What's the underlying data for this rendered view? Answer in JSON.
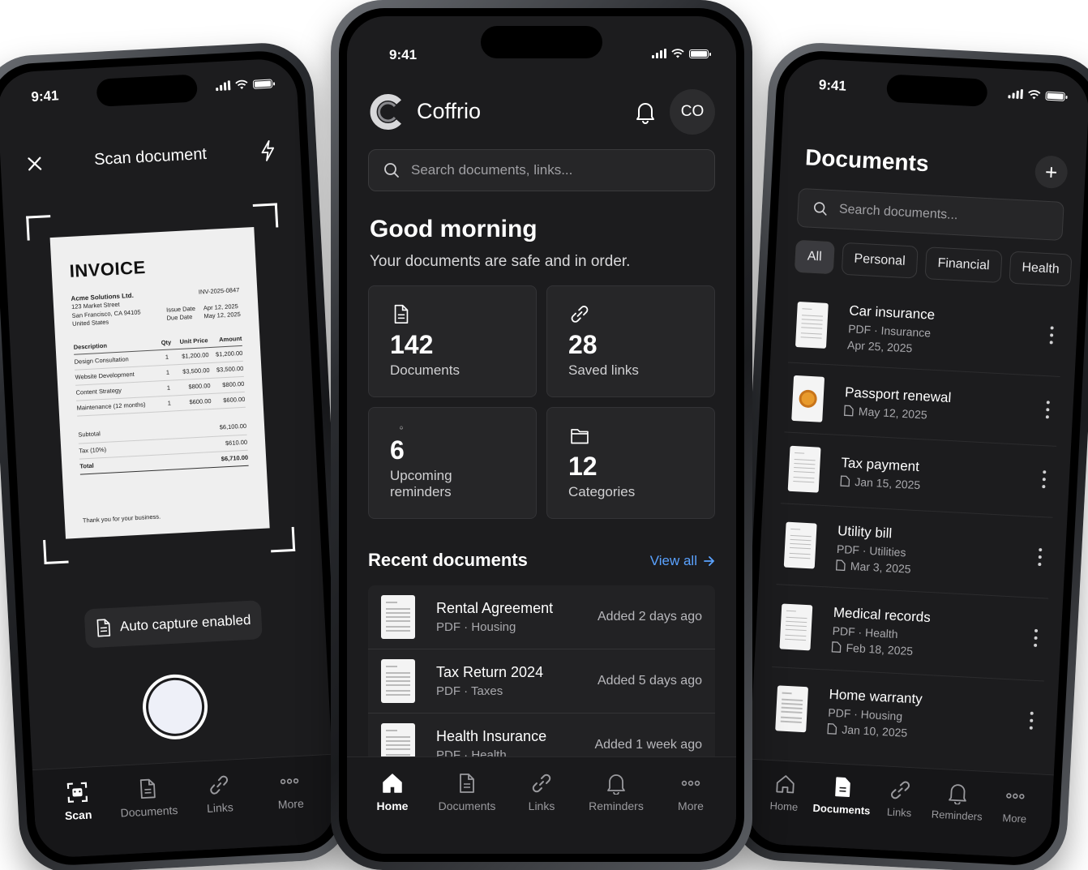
{
  "status": {
    "time": "9:41"
  },
  "scan_phone": {
    "title": "Scan document",
    "invoice": {
      "title": "INVOICE",
      "number": "INV-2025-0847",
      "company": "Acme Solutions Ltd.",
      "address_lines": [
        "123 Market Street",
        "San Francisco, CA 94105",
        "United States"
      ],
      "issue_label": "Issue Date",
      "issue_value": "Apr 12, 2025",
      "due_label": "Due Date",
      "due_value": "May 12, 2025",
      "headers": [
        "Description",
        "Qty",
        "Unit Price",
        "Amount"
      ],
      "rows": [
        [
          "Design Consultation",
          "1",
          "$1,200.00",
          "$1,200.00"
        ],
        [
          "Website Development",
          "1",
          "$3,500.00",
          "$3,500.00"
        ],
        [
          "Content Strategy",
          "1",
          "$800.00",
          "$800.00"
        ],
        [
          "Maintenance (12 months)",
          "1",
          "$600.00",
          "$600.00"
        ]
      ],
      "subtotal_label": "Subtotal",
      "subtotal_value": "$6,100.00",
      "tax_label": "Tax (10%)",
      "tax_value": "$610.00",
      "total_label": "Total",
      "total_value": "$6,710.00",
      "thanks": "Thank you for your business."
    },
    "auto_capture": "Auto capture enabled",
    "tabs": [
      "Scan",
      "Documents",
      "Links",
      "More"
    ]
  },
  "home_phone": {
    "app_name": "Coffrio",
    "avatar": "CO",
    "search_placeholder": "Search documents, links...",
    "greeting": "Good morning",
    "greeting_sub": "Your documents are safe and in order.",
    "stats": [
      {
        "value": "142",
        "label": "Documents"
      },
      {
        "value": "28",
        "label": "Saved links"
      },
      {
        "value": "6",
        "label": "Upcoming reminders"
      },
      {
        "value": "12",
        "label": "Categories"
      }
    ],
    "recent_title": "Recent documents",
    "view_all": "View all",
    "recent": [
      {
        "name": "Rental Agreement",
        "meta": "PDF · Housing",
        "when": "Added 2 days ago"
      },
      {
        "name": "Tax Return 2024",
        "meta": "PDF · Taxes",
        "when": "Added 5 days ago"
      },
      {
        "name": "Health Insurance",
        "meta": "PDF · Health",
        "when": "Added 1 week ago"
      }
    ],
    "tabs": [
      "Home",
      "Documents",
      "Links",
      "Reminders",
      "More"
    ]
  },
  "docs_phone": {
    "title": "Documents",
    "add": "+",
    "search_placeholder": "Search documents...",
    "chips": [
      "All",
      "Personal",
      "Financial",
      "Health"
    ],
    "docs": [
      {
        "name": "Car insurance",
        "meta": "PDF · Insurance",
        "date": "Apr 25, 2025"
      },
      {
        "name": "Passport renewal",
        "meta": "",
        "date": "May 12, 2025"
      },
      {
        "name": "Tax payment",
        "meta": "",
        "date": "Jan 15, 2025"
      },
      {
        "name": "Utility bill",
        "meta": "PDF · Utilities",
        "date": "Mar 3, 2025"
      },
      {
        "name": "Medical records",
        "meta": "PDF · Health",
        "date": "Feb 18, 2025"
      },
      {
        "name": "Home warranty",
        "meta": "PDF · Housing",
        "date": "Jan 10, 2025"
      }
    ],
    "tabs": [
      "Home",
      "Documents",
      "Links",
      "Reminders",
      "More"
    ]
  }
}
